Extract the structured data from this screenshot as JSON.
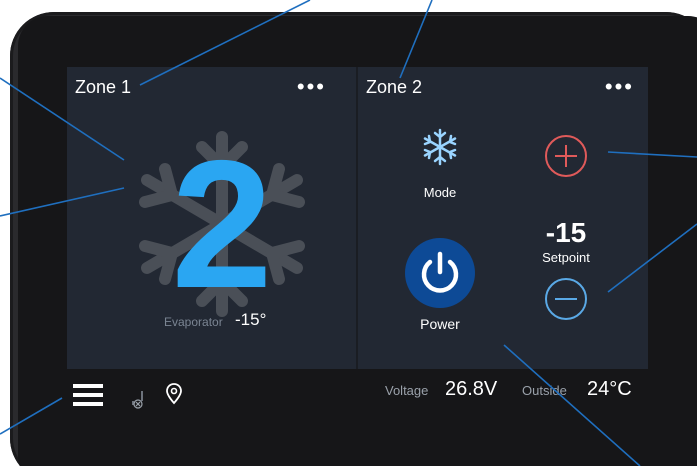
{
  "zone1": {
    "title": "Zone 1",
    "menu_glyph": "•••",
    "big_number": "2",
    "evaporator_label": "Evaporator",
    "evaporator_value": "-15°"
  },
  "zone2": {
    "title": "Zone 2",
    "menu_glyph": "•••",
    "mode_label": "Mode",
    "power_label": "Power",
    "setpoint_value": "-15",
    "setpoint_label": "Setpoint"
  },
  "status": {
    "voltage_label": "Voltage",
    "voltage_value": "26.8V",
    "outside_label": "Outside",
    "outside_value": "24°C"
  },
  "icons": {
    "menu": "hamburger-menu-icon",
    "signal": "no-signal-icon",
    "location": "location-pin-icon",
    "mode": "snowflake-icon",
    "power": "power-icon",
    "plus": "plus-icon",
    "minus": "minus-icon"
  },
  "colors": {
    "accent_blue": "#2aa6f2",
    "power_blue": "#0d4a96",
    "plus_red": "#e05a5a",
    "minus_blue": "#5aa9e6",
    "callout_line": "#1f6fbf"
  }
}
